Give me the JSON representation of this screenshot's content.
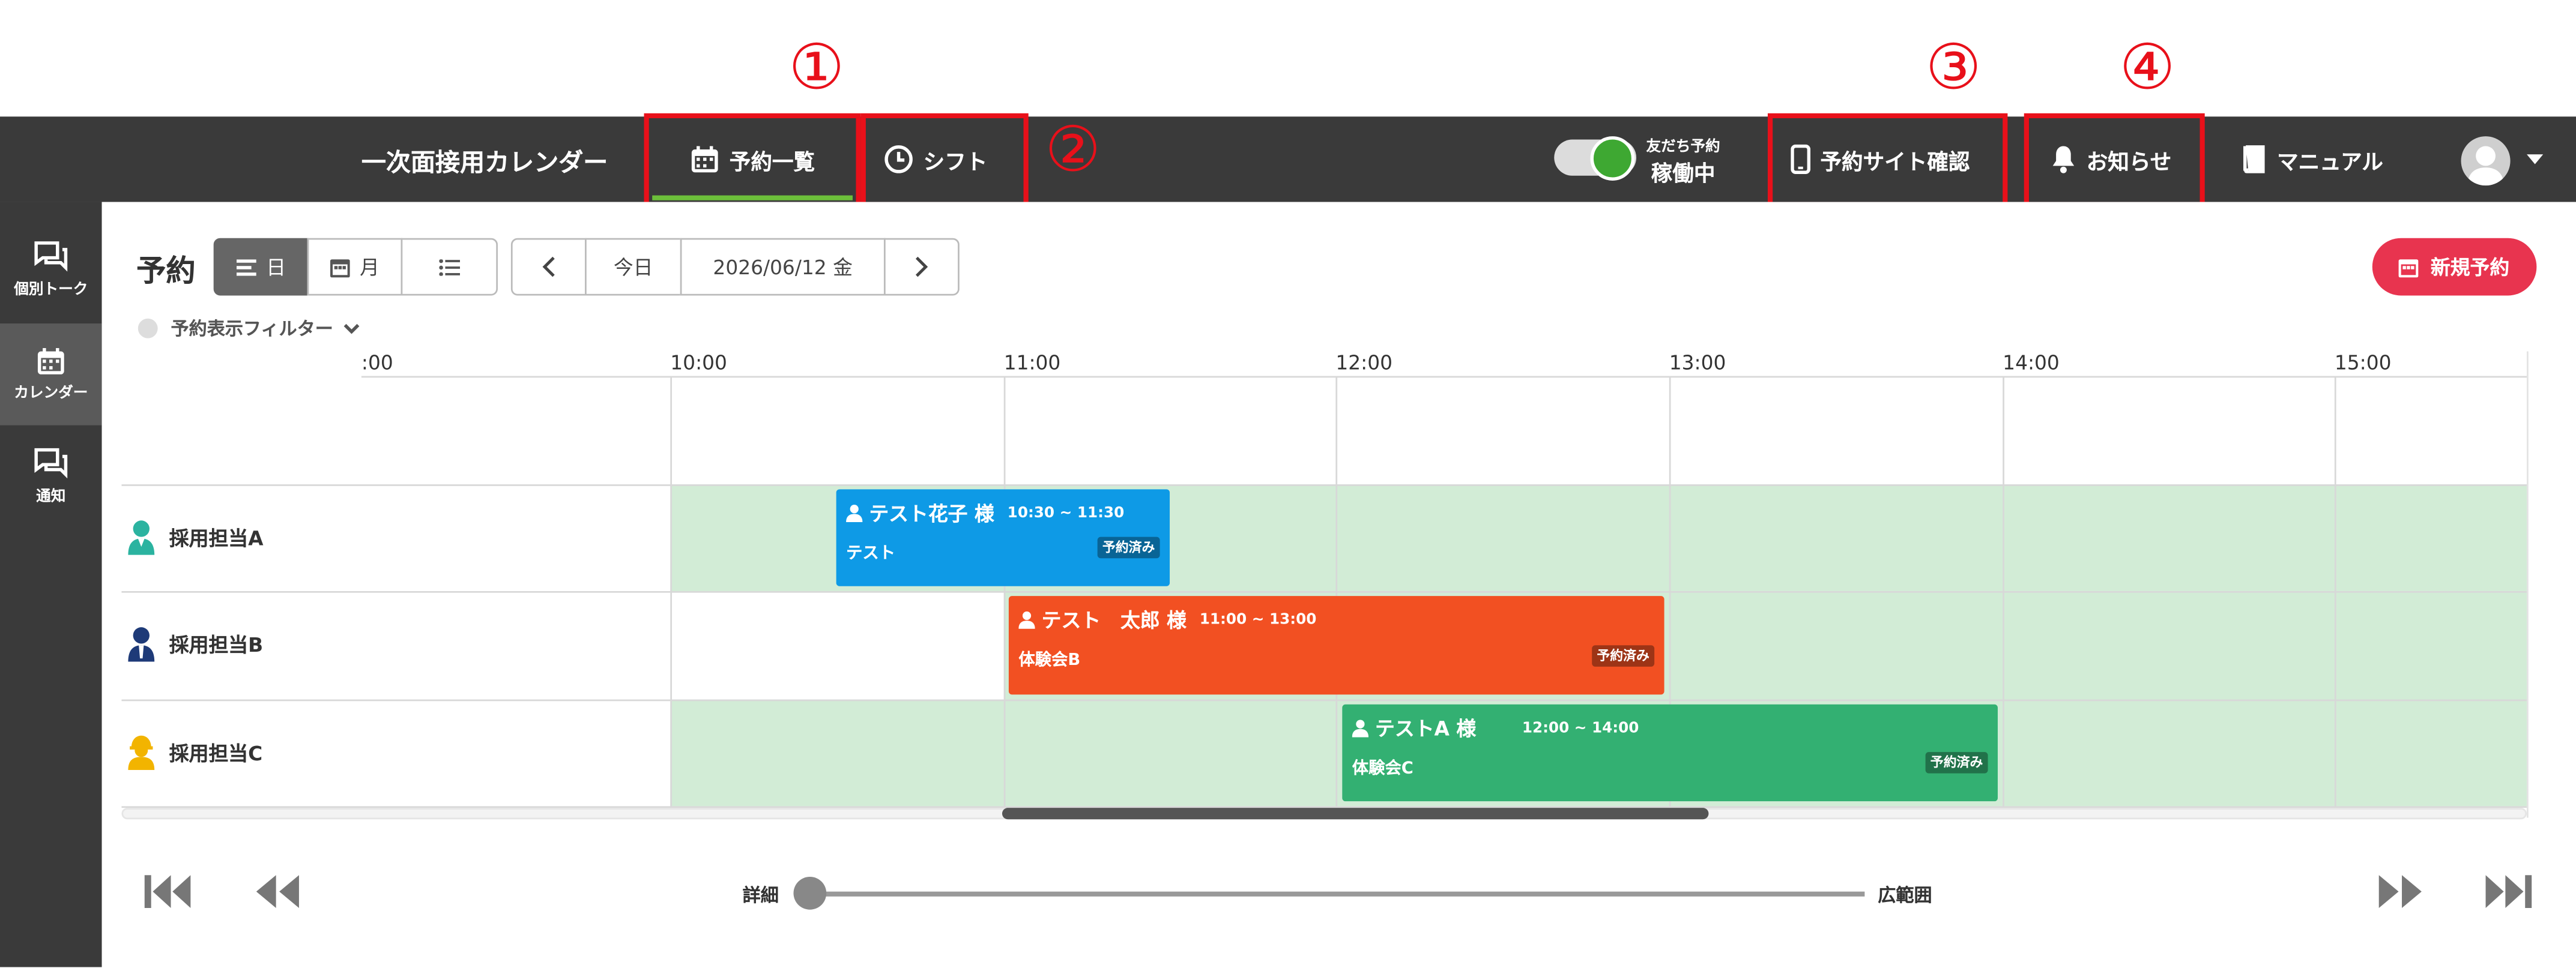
{
  "header": {
    "app_name": "一次面接用カレンダー",
    "tabs": [
      {
        "label": "予約一覧",
        "icon": "calendar-icon"
      },
      {
        "label": "シフト",
        "icon": "clock-icon"
      }
    ],
    "friend_status_label": "友だち予約",
    "friend_status_value": "稼働中",
    "site_check_label": "予約サイト確認",
    "notice_label": "お知らせ",
    "manual_label": "マニュアル"
  },
  "annotations": [
    "①",
    "②",
    "③",
    "④"
  ],
  "sidebar": {
    "items": [
      {
        "label": "個別トーク",
        "icon": "chat-icon"
      },
      {
        "label": "カレンダー",
        "icon": "calendar-icon"
      },
      {
        "label": "通知",
        "icon": "chat-icon"
      }
    ]
  },
  "toolbar": {
    "title": "予約",
    "view_day": "日",
    "view_month": "月",
    "today": "今日",
    "date": "2026/06/12 金",
    "new_reservation": "新規予約",
    "filter_label": "予約表示フィルター"
  },
  "timeline": {
    "hours": [
      ":00",
      "10:00",
      "11:00",
      "12:00",
      "13:00",
      "14:00",
      "15:00"
    ],
    "staff": [
      {
        "name": "採用担当A",
        "color": "#2bb3a0"
      },
      {
        "name": "採用担当B",
        "color": "#1e3a78"
      },
      {
        "name": "採用担当C",
        "color": "#f2b400"
      }
    ],
    "events": [
      {
        "title": "テスト花子 様",
        "time": "10:30 ~ 11:30",
        "desc": "テスト",
        "badge": "予約済み",
        "color": "#0e9ae6"
      },
      {
        "title": "テスト　太郎 様",
        "time": "11:00 ~ 13:00",
        "desc": "体験会B",
        "badge": "予約済み",
        "color": "#f25022"
      },
      {
        "title": "テストA 様",
        "time": "12:00 ~ 14:00",
        "desc": "体験会C",
        "badge": "予約済み",
        "color": "#33b072"
      }
    ]
  },
  "zoom": {
    "min_label": "詳細",
    "max_label": "広範囲"
  }
}
